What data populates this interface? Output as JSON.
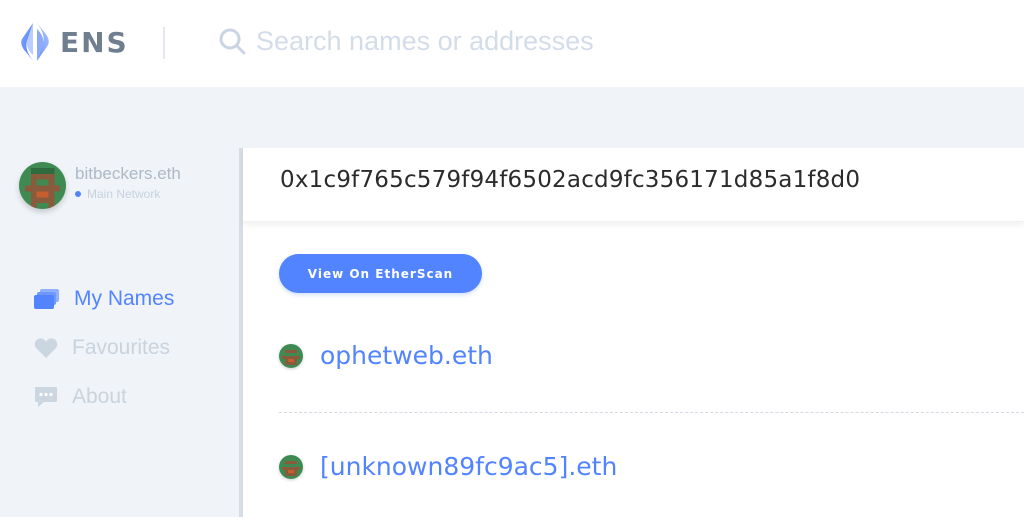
{
  "header": {
    "logo_text": "ENS",
    "search_placeholder": "Search names or addresses"
  },
  "account": {
    "name": "bitbeckers.eth",
    "network": "Main Network"
  },
  "nav": {
    "items": [
      {
        "label": "My Names",
        "icon": "cards-icon",
        "active": true
      },
      {
        "label": "Favourites",
        "icon": "heart-icon",
        "active": false
      },
      {
        "label": "About",
        "icon": "chat-bubble-icon",
        "active": false
      }
    ]
  },
  "main": {
    "address": "0x1c9f765c579f94f6502acd9fc356171d85a1f8d0",
    "etherscan_label": "View On EtherScan",
    "names": [
      {
        "name": "ophetweb.eth"
      },
      {
        "name": "[unknown89fc9ac5].eth"
      }
    ]
  },
  "colors": {
    "accent": "#5284ff",
    "header_bg": "#ffffff",
    "page_bg": "#f0f4f9",
    "avatar_green": "#3e8a52",
    "avatar_brown": "#8a5a3c"
  }
}
